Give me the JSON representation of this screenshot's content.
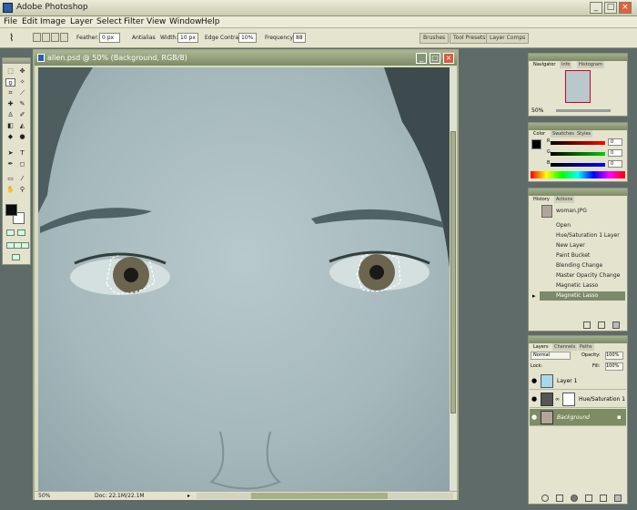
{
  "app": {
    "title": "Adobe Photoshop"
  },
  "window_controls": {
    "minimize": "_",
    "maximize": "□",
    "close": "×"
  },
  "menu": [
    "File",
    "Edit",
    "Image",
    "Layer",
    "Select",
    "Filter",
    "View",
    "Window",
    "Help"
  ],
  "options": {
    "feather_label": "Feather:",
    "feather_value": "0 px",
    "antialias_label": "Antialias",
    "width_label": "Width:",
    "width_value": "10 px",
    "edge_contrast_label": "Edge Contrast:",
    "edge_contrast_value": "10%",
    "frequency_label": "Frequency:",
    "frequency_value": "88"
  },
  "palette_well": [
    "Brushes",
    "Tool Presets",
    "Layer Comps"
  ],
  "document": {
    "title": "alien.psd @ 50% (Background, RGB/8)",
    "zoom": "50%",
    "doc_size": "Doc: 22.1M/22.1M"
  },
  "navigator": {
    "tabs": [
      "Navigator",
      "Info",
      "Histogram"
    ],
    "zoom": "50%"
  },
  "color": {
    "tabs": [
      "Color",
      "Swatches",
      "Styles"
    ],
    "channels": [
      {
        "label": "R",
        "value": "0"
      },
      {
        "label": "G",
        "value": "0"
      },
      {
        "label": "B",
        "value": "0"
      }
    ]
  },
  "history": {
    "tabs": [
      "History",
      "Actions"
    ],
    "snapshot": "woman.JPG",
    "items": [
      "Open",
      "Hue/Saturation 1 Layer",
      "New Layer",
      "Paint Bucket",
      "Blending Change",
      "Master Opacity Change",
      "Magnetic Lasso",
      "Magnetic Lasso"
    ]
  },
  "layers": {
    "tabs": [
      "Layers",
      "Channels",
      "Paths"
    ],
    "blend_mode": "Normal",
    "opacity_label": "Opacity:",
    "opacity": "100%",
    "lock_label": "Lock:",
    "fill_label": "Fill:",
    "fill": "100%",
    "items": [
      {
        "name": "Layer 1"
      },
      {
        "name": "Hue/Saturation 1"
      },
      {
        "name": "Background"
      }
    ]
  },
  "colors": {
    "doc_title_bar": "#7c8a63",
    "selected": "#7d8c63"
  }
}
